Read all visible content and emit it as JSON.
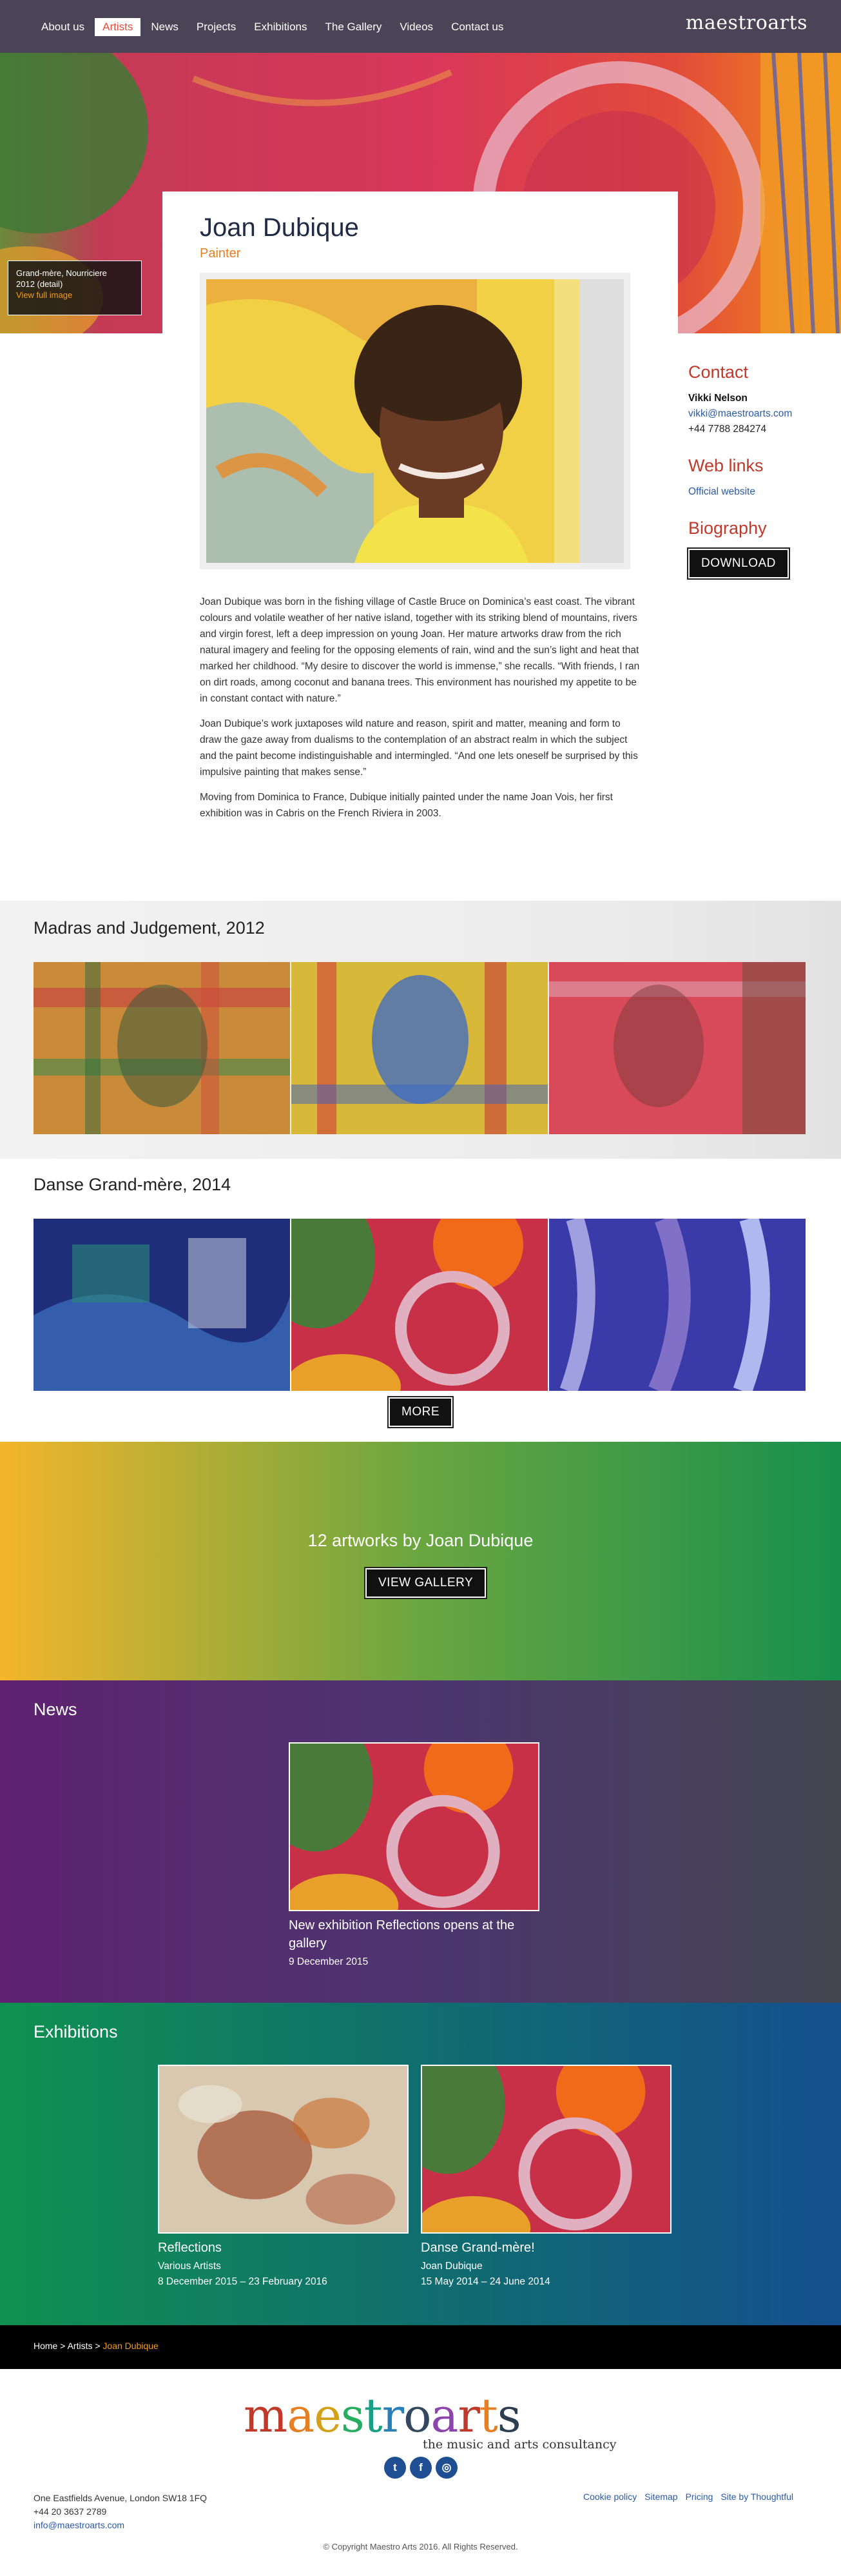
{
  "nav": {
    "items": [
      {
        "label": "About us",
        "active": false
      },
      {
        "label": "Artists",
        "active": true
      },
      {
        "label": "News",
        "active": false
      },
      {
        "label": "Projects",
        "active": false
      },
      {
        "label": "Exhibitions",
        "active": false
      },
      {
        "label": "The Gallery",
        "active": false
      },
      {
        "label": "Videos",
        "active": false
      },
      {
        "label": "Contact us",
        "active": false
      }
    ],
    "brand": "maestroarts"
  },
  "hero": {
    "caption_title": "Grand-mère, Nourriciere",
    "caption_meta": "2012 (detail)",
    "caption_link": "View full image"
  },
  "artist": {
    "name": "Joan Dubique",
    "role": "Painter",
    "bio": [
      "Joan Dubique was born in the fishing village of Castle Bruce on Dominica’s east coast. The vibrant colours and volatile weather of her native island, together with its striking blend of mountains, rivers and virgin forest, left a deep impression on young Joan. Her mature artworks draw from the rich natural imagery and feeling for the opposing elements of rain, wind and the sun’s light and heat that marked her childhood. “My desire to discover the world is immense,” she recalls. “With friends, I ran on dirt roads, among coconut and banana trees. This environment has nourished my appetite to be in constant contact with nature.”",
      "Joan Dubique’s work juxtaposes wild nature and reason, spirit and matter, meaning and form to draw the gaze away from dualisms to the contemplation of an abstract realm in which the subject and the paint become indistinguishable and intermingled. “And one lets oneself be surprised by this impulsive painting that makes sense.”",
      "Moving from Dominica to France, Dubique initially painted under the name Joan Vois, her first exhibition was in Cabris on the French Riviera in 2003."
    ]
  },
  "sidebar": {
    "contact_heading": "Contact",
    "contact_name": "Vikki Nelson",
    "contact_email": "vikki@maestroarts.com",
    "contact_phone": "+44 7788 284274",
    "weblinks_heading": "Web links",
    "weblink_label": "Official website",
    "biography_heading": "Biography",
    "download_label": "DOWNLOAD"
  },
  "series": [
    {
      "title": "Madras and Judgement, 2012"
    },
    {
      "title": "Danse Grand-mère, 2014"
    }
  ],
  "more_label": "MORE",
  "banner": {
    "title": "12 artworks by Joan Dubique",
    "button": "VIEW GALLERY"
  },
  "news": {
    "heading": "News",
    "items": [
      {
        "title": "New exhibition Reflections opens at the gallery",
        "date": "9 December 2015"
      }
    ]
  },
  "exhibitions": {
    "heading": "Exhibitions",
    "items": [
      {
        "title": "Reflections",
        "artist": "Various Artists",
        "dates": "8 December 2015 – 23 February 2016"
      },
      {
        "title": "Danse Grand-mère!",
        "artist": "Joan Dubique",
        "dates": "15 May 2014 – 24 June 2014"
      }
    ]
  },
  "breadcrumb": {
    "home": "Home",
    "sep": ">",
    "section": "Artists",
    "current": "Joan Dubique"
  },
  "footer": {
    "logo": "maestroarts",
    "tagline": "the music and arts consultancy",
    "social": [
      "twitter-icon",
      "facebook-icon",
      "instagram-icon"
    ],
    "address": "One Eastfields Avenue, London SW18 1FQ",
    "phone": "+44 20 3637 2789",
    "email": "info@maestroarts.com",
    "links": [
      "Cookie policy",
      "Sitemap",
      "Pricing",
      "Site by Thoughtful"
    ],
    "copyright": "© Copyright Maestro Arts 2016. All Rights Reserved."
  },
  "colors": {
    "accent_orange": "#e67e22",
    "heading_red": "#c0392b",
    "link_blue": "#2b5aa8",
    "nav_bg": "#4a4456"
  }
}
